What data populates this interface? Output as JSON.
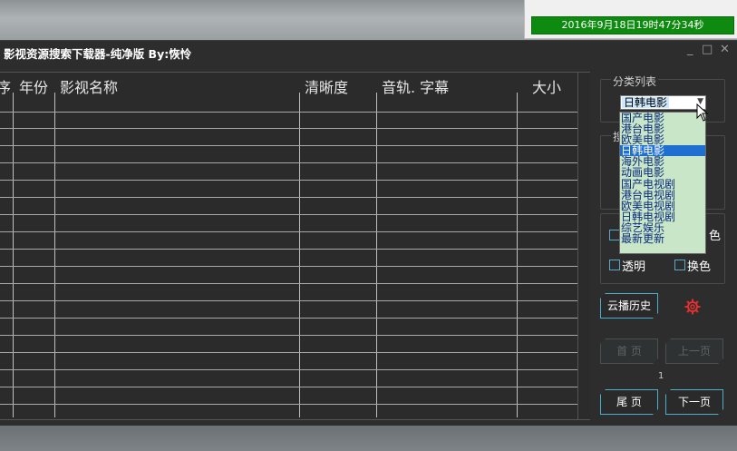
{
  "status": {
    "datetime": "2016年9月18日19时47分34秒"
  },
  "window": {
    "title": "影视资源搜索下载器-纯净版 By:恢怜",
    "min": "_",
    "max": "□",
    "close": "✕"
  },
  "table": {
    "columns": [
      "序",
      "年份",
      "影视名称",
      "清晰度",
      "音轨. 字幕",
      "大小"
    ]
  },
  "sidebar": {
    "category_group_label": "分类列表",
    "selected": "日韩电影",
    "options": [
      "国产电影",
      "港台电影",
      "欧美电影",
      "日韩电影",
      "海外电影",
      "动画电影",
      "国产电视剧",
      "港台电视剧",
      "欧美电视剧",
      "日韩电视剧",
      "综艺娱乐",
      "最新更新"
    ],
    "selected_index": 3,
    "hidden_group_label": "搜"
  },
  "options": {
    "transparent": {
      "label": "透明",
      "checked": false
    },
    "recolor": {
      "label": "换色",
      "checked": false
    },
    "hidden_right": "色"
  },
  "buttons": {
    "history": "云播历史",
    "first": "首 页",
    "prev": "上一页",
    "last": "尾 页",
    "next": "下一页"
  },
  "pagination": {
    "page": "1"
  },
  "icons": {
    "settings": "gear-icon",
    "cursor": "arrow-cursor"
  },
  "colors": {
    "accent": "#4ab0cc",
    "status_green": "#0f8a10",
    "settings_red": "#e03030"
  }
}
